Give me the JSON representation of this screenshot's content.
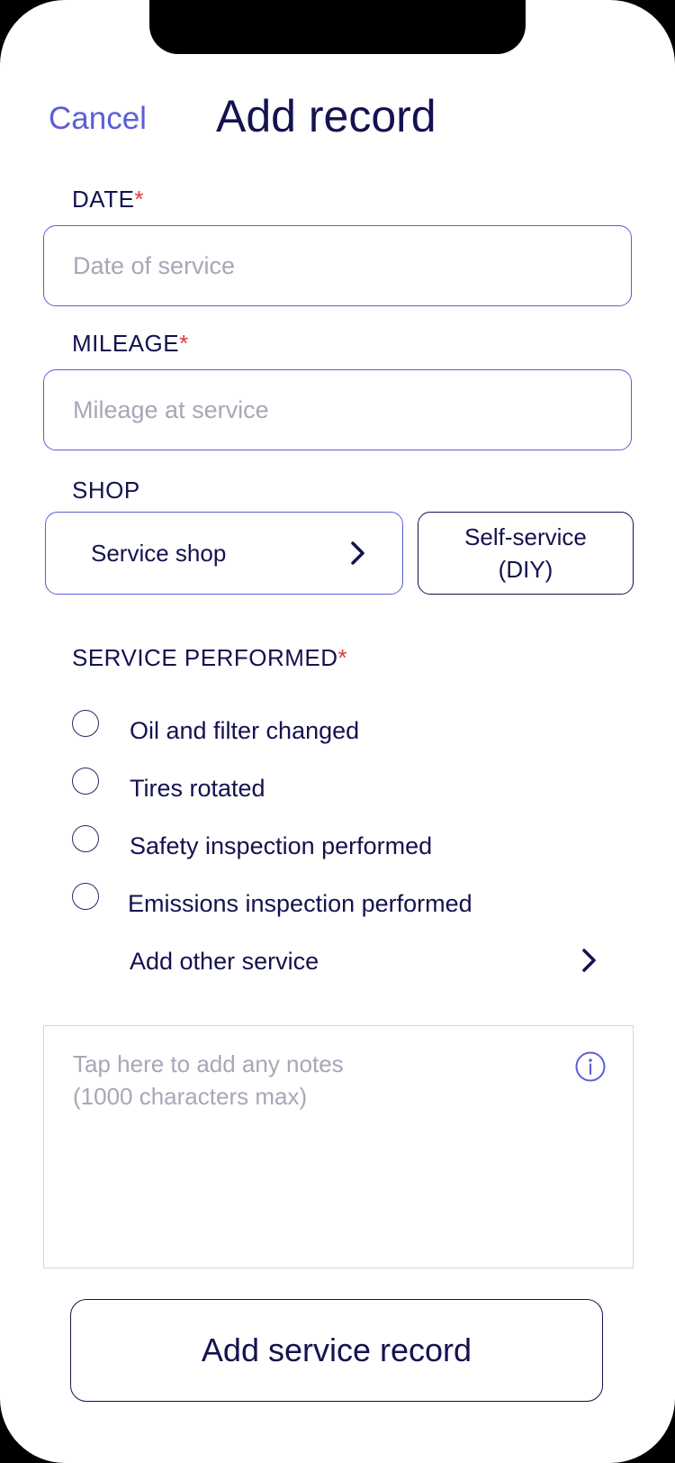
{
  "header": {
    "cancel_label": "Cancel",
    "title": "Add record"
  },
  "form": {
    "date": {
      "label": "DATE",
      "required_mark": "*",
      "placeholder": "Date of service"
    },
    "mileage": {
      "label": "MILEAGE",
      "required_mark": "*",
      "placeholder": "Mileage at service"
    },
    "shop": {
      "label": "SHOP",
      "options": [
        {
          "label": "Service shop",
          "icon": "chevron-right-icon"
        },
        {
          "label": "Self-service\n(DIY)"
        }
      ]
    },
    "service": {
      "label": "SERVICE PERFORMED",
      "required_mark": "*",
      "options": [
        {
          "label": "Oil and filter changed",
          "selected": false
        },
        {
          "label": "Tires rotated",
          "selected": false
        },
        {
          "label": "Safety inspection performed",
          "selected": false
        },
        {
          "label": "Emissions inspection performed",
          "selected": false
        }
      ],
      "add_other_label": "Add other service",
      "add_other_icon": "chevron-right-icon"
    },
    "notes": {
      "placeholder_line1": "Tap here to add any notes",
      "placeholder_line2": "(1000 characters max)",
      "icon": "info-icon"
    },
    "submit_label": "Add service record"
  },
  "colors": {
    "accent": "#5a5fd6",
    "text": "#14124f",
    "placeholder": "#a7a7b7",
    "required": "#e23a3a"
  }
}
